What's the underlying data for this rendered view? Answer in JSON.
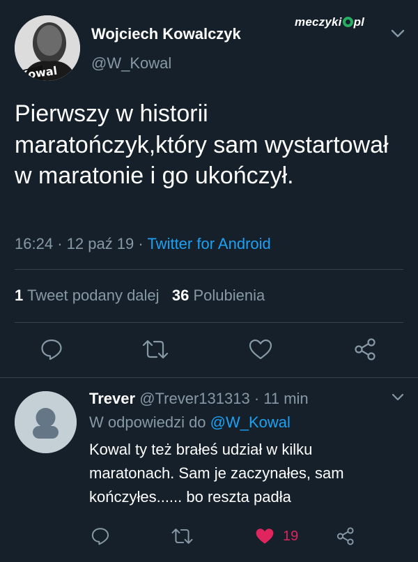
{
  "main_tweet": {
    "author_name": "Wojciech Kowalczyk",
    "author_handle": "@W_Kowal",
    "text": "Pierwszy w historii maratończyk,który sam wystartował w maratonie i go ukończył.",
    "time": "16:24",
    "date": "12 paź 19",
    "separator": "·",
    "source": "Twitter for Android",
    "retweet_count": "1",
    "retweet_label": "Tweet podany dalej",
    "like_count": "36",
    "like_label": "Polubienia"
  },
  "watermark": {
    "brand_prefix": "meczyki",
    "brand_suffix": "pl"
  },
  "reply": {
    "author_name": "Trever",
    "author_handle": "@Trever131313",
    "separator": "·",
    "time_ago": "11 min",
    "reply_to_label": "W odpowiedzi do",
    "reply_to_handle": "@W_Kowal",
    "text": "Kowal ty też brałeś udział w kilku maratonach. Sam je zaczynałes, sam kończyłes...... bo reszta padła",
    "like_count": "19"
  },
  "icons": {
    "reply": "reply-icon",
    "retweet": "retweet-icon",
    "like": "heart-icon",
    "share": "share-icon",
    "menu": "chevron-down-icon"
  },
  "colors": {
    "background": "#15202b",
    "muted": "#8899a6",
    "link": "#1da1f2",
    "liked": "#e0245e",
    "divider": "#38444d"
  }
}
